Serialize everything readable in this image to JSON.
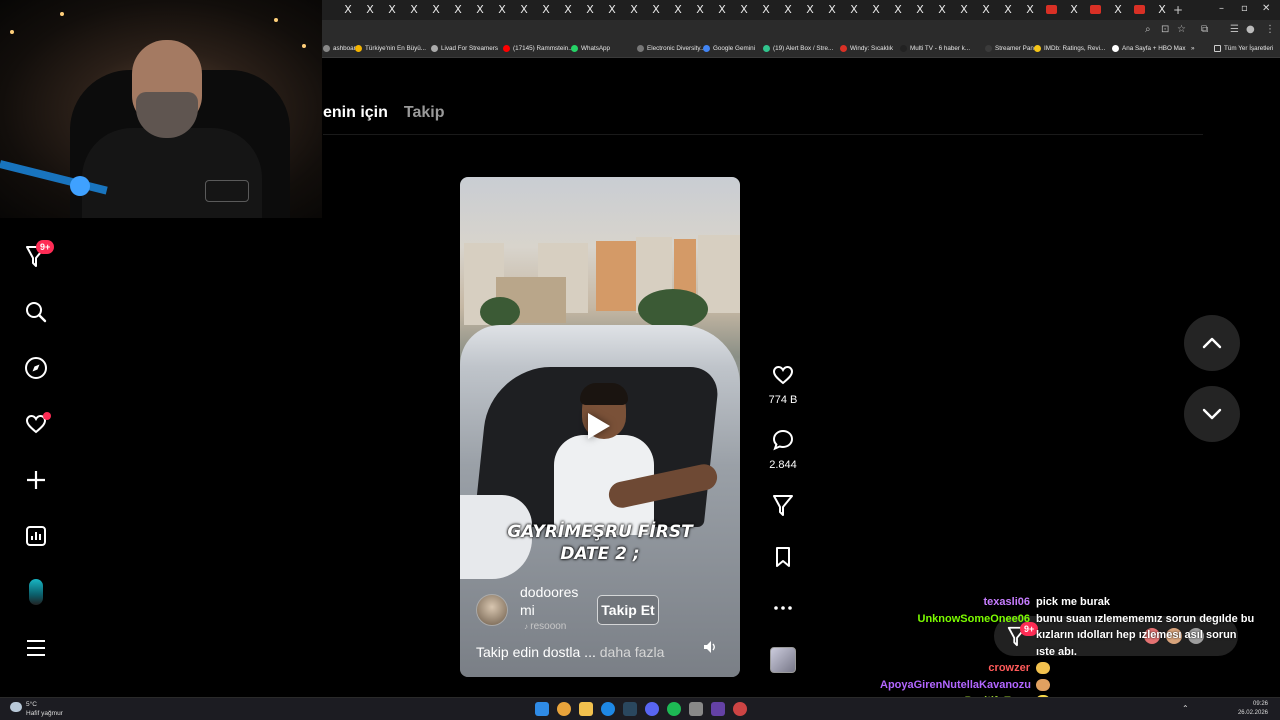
{
  "browser": {
    "tab_close_glyph": "X",
    "bookmarks": [
      {
        "label": "ashboard",
        "color": "#888888"
      },
      {
        "label": "Türkiye'nin En Büyü...",
        "color": "#f4b400"
      },
      {
        "label": "Livad For Streamers",
        "color": "#aaaaaa"
      },
      {
        "label": "(17145) Rammstein...",
        "color": "#ff0000"
      },
      {
        "label": "WhatsApp",
        "color": "#25d366"
      },
      {
        "label": "Electronic Diversity...",
        "color": "#777777"
      },
      {
        "label": "Google Gemini",
        "color": "#4285f4"
      },
      {
        "label": "(19) Alert Box / Stre...",
        "color": "#31c48d"
      },
      {
        "label": "Windy: Sıcaklık",
        "color": "#d93025"
      },
      {
        "label": "Multi TV - 6 haber k...",
        "color": "#222222"
      },
      {
        "label": "Streamer Panel",
        "color": "#3a3a3a"
      },
      {
        "label": "IMDb: Ratings, Revi...",
        "color": "#f5c518"
      },
      {
        "label": "Ana Sayfa + HBO Max",
        "color": "#ffffff"
      }
    ],
    "bookmarks_overflow": "»",
    "all_bookmarks": "Tüm Yer İşaretleri"
  },
  "tiktok": {
    "tabs": {
      "for_you": "enin için",
      "following": "Takip"
    },
    "sidebar": {
      "messages_badge": "9+"
    },
    "video": {
      "caption_line1": "GAYRİMEŞRU FİRST",
      "caption_line2": "DATE 2 ;",
      "username": "dodoores mi",
      "sub": "resooon",
      "follow_label": "Takip Et",
      "description": "Takip edin dostla ...",
      "more_label": "daha fazla"
    },
    "actions": {
      "likes": "774 B",
      "comments": "2.844"
    }
  },
  "chat": {
    "messages": [
      {
        "user": "texasli06",
        "color": "#c77dff",
        "text": "pick me burak"
      },
      {
        "user": "UnknowSomeOnee06",
        "color": "#7cfc00",
        "text": "bunu suan ızlemememız sorun degılde bu kızların ıdolları hep ızlemesı asıl sorun ıste abı."
      },
      {
        "user": "crowzer",
        "color": "#ff5a5a",
        "text": ""
      },
      {
        "user": "ApoyaGirenNutellaKavanozu",
        "color": "#b266ff",
        "text": ""
      },
      {
        "user": "Pozitif_Enes",
        "color": "#9acd32",
        "text": ""
      }
    ]
  },
  "taskbar": {
    "weather_temp": "5°C",
    "weather_desc": "Hafif yağmur",
    "time": "09:26",
    "date": "26.02.2026"
  }
}
